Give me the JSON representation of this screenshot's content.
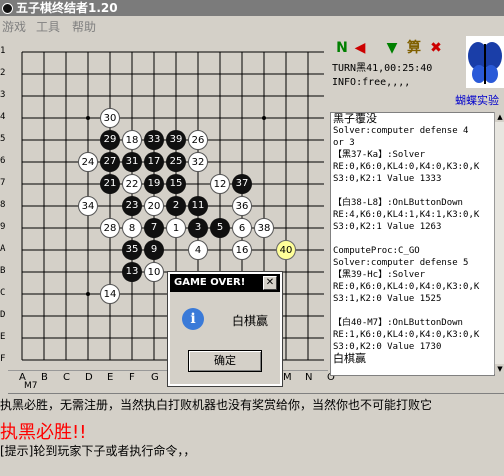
{
  "window": {
    "title": "五子棋终结者1.20"
  },
  "menu": {
    "items": [
      "游戏",
      "工具",
      "帮助"
    ]
  },
  "board": {
    "row_labels": [
      "1",
      "2",
      "3",
      "4",
      "5",
      "6",
      "7",
      "8",
      "9",
      "A",
      "B",
      "C",
      "D",
      "E",
      "F"
    ],
    "col_labels": [
      "A",
      "B",
      "C",
      "D",
      "E",
      "F",
      "G",
      "H",
      "I",
      "J",
      "K",
      "L",
      "M",
      "N",
      "O"
    ],
    "stones": [
      {
        "color": "white",
        "label": "30",
        "col": "E",
        "row": "4"
      },
      {
        "color": "black",
        "label": "29",
        "col": "E",
        "row": "5"
      },
      {
        "color": "white",
        "label": "18",
        "col": "F",
        "row": "5"
      },
      {
        "color": "black",
        "label": "33",
        "col": "G",
        "row": "5"
      },
      {
        "color": "black",
        "label": "39",
        "col": "H",
        "row": "5"
      },
      {
        "color": "white",
        "label": "26",
        "col": "I",
        "row": "5"
      },
      {
        "color": "white",
        "label": "24",
        "col": "D",
        "row": "6"
      },
      {
        "color": "black",
        "label": "27",
        "col": "E",
        "row": "6"
      },
      {
        "color": "black",
        "label": "31",
        "col": "F",
        "row": "6"
      },
      {
        "color": "black",
        "label": "17",
        "col": "G",
        "row": "6"
      },
      {
        "color": "black",
        "label": "25",
        "col": "H",
        "row": "6"
      },
      {
        "color": "white",
        "label": "32",
        "col": "I",
        "row": "6"
      },
      {
        "color": "black",
        "label": "21",
        "col": "E",
        "row": "7"
      },
      {
        "color": "white",
        "label": "22",
        "col": "F",
        "row": "7"
      },
      {
        "color": "black",
        "label": "19",
        "col": "G",
        "row": "7"
      },
      {
        "color": "black",
        "label": "15",
        "col": "H",
        "row": "7"
      },
      {
        "color": "white",
        "label": "12",
        "col": "J",
        "row": "7"
      },
      {
        "color": "black",
        "label": "37",
        "col": "K",
        "row": "7"
      },
      {
        "color": "white",
        "label": "34",
        "col": "D",
        "row": "8"
      },
      {
        "color": "black",
        "label": "23",
        "col": "F",
        "row": "8"
      },
      {
        "color": "white",
        "label": "20",
        "col": "G",
        "row": "8"
      },
      {
        "color": "black",
        "label": "2",
        "col": "H",
        "row": "8"
      },
      {
        "color": "black",
        "label": "11",
        "col": "I",
        "row": "8"
      },
      {
        "color": "white",
        "label": "36",
        "col": "K",
        "row": "8"
      },
      {
        "color": "white",
        "label": "28",
        "col": "E",
        "row": "9"
      },
      {
        "color": "white",
        "label": "8",
        "col": "F",
        "row": "9"
      },
      {
        "color": "black",
        "label": "7",
        "col": "G",
        "row": "9"
      },
      {
        "color": "white",
        "label": "1",
        "col": "H",
        "row": "9"
      },
      {
        "color": "black",
        "label": "3",
        "col": "I",
        "row": "9"
      },
      {
        "color": "black",
        "label": "5",
        "col": "J",
        "row": "9"
      },
      {
        "color": "white",
        "label": "6",
        "col": "K",
        "row": "9"
      },
      {
        "color": "white",
        "label": "38",
        "col": "L",
        "row": "9"
      },
      {
        "color": "black",
        "label": "35",
        "col": "F",
        "row": "A"
      },
      {
        "color": "black",
        "label": "9",
        "col": "G",
        "row": "A"
      },
      {
        "color": "white",
        "label": "4",
        "col": "I",
        "row": "A"
      },
      {
        "color": "white",
        "label": "16",
        "col": "K",
        "row": "A"
      },
      {
        "color": "last",
        "label": "40",
        "col": "M",
        "row": "A"
      },
      {
        "color": "black",
        "label": "13",
        "col": "F",
        "row": "B"
      },
      {
        "color": "white",
        "label": "10",
        "col": "G",
        "row": "B"
      },
      {
        "color": "white",
        "label": "14",
        "col": "E",
        "row": "C"
      }
    ]
  },
  "toolbar": {
    "icons": [
      "new-game-icon",
      "undo-icon",
      "redo-icon",
      "compute-icon",
      "stop-icon"
    ],
    "compute_glyph": "算",
    "stop_glyph": "✖",
    "new_glyph": "N"
  },
  "status": {
    "turn": "TURN黑41,00:25:40",
    "info": "INFO:free,,,,"
  },
  "logo": {
    "label": "蝴蝶实验"
  },
  "log": [
    "黑子覆没",
    "Solver:computer defense 4",
    "or 3",
    "【黑37-Ka】:Solver",
    "RE:0,K6:0,KL4:0,K4:0,K3:0,K",
    "S3:0,K2:1 Value 1333",
    "",
    "【白38-L8】:OnLButtonDown",
    "RE:4,K6:0,KL4:1,K4:1,K3:0,K",
    "S3:0,K2:1 Value 1263",
    "",
    "ComputeProc:C_GO",
    "Solver:computer defense 5",
    "【黑39-Hc】:Solver",
    "RE:0,K6:0,KL4:0,K4:0,K3:0,K",
    "S3:1,K2:0 Value 1525",
    "",
    "【白40-M7】:OnLButtonDown",
    "RE:1,K6:0,KL4:0,K4:0,K3:0,K",
    "S3:0,K2:0 Value 1730",
    "白棋赢"
  ],
  "coord": "M7",
  "dialog": {
    "title": "GAME OVER!",
    "close": "✕",
    "message": "白棋赢",
    "ok_label": "确定",
    "icon_glyph": "i"
  },
  "messages": {
    "line1": "执黑必胜，无需注册，当然执白打败机器也没有奖赏给你，当然你也不可能打败它",
    "line2": "执黑必胜!!",
    "line3": "[提示]轮到玩家下子或者执行命令，，"
  }
}
